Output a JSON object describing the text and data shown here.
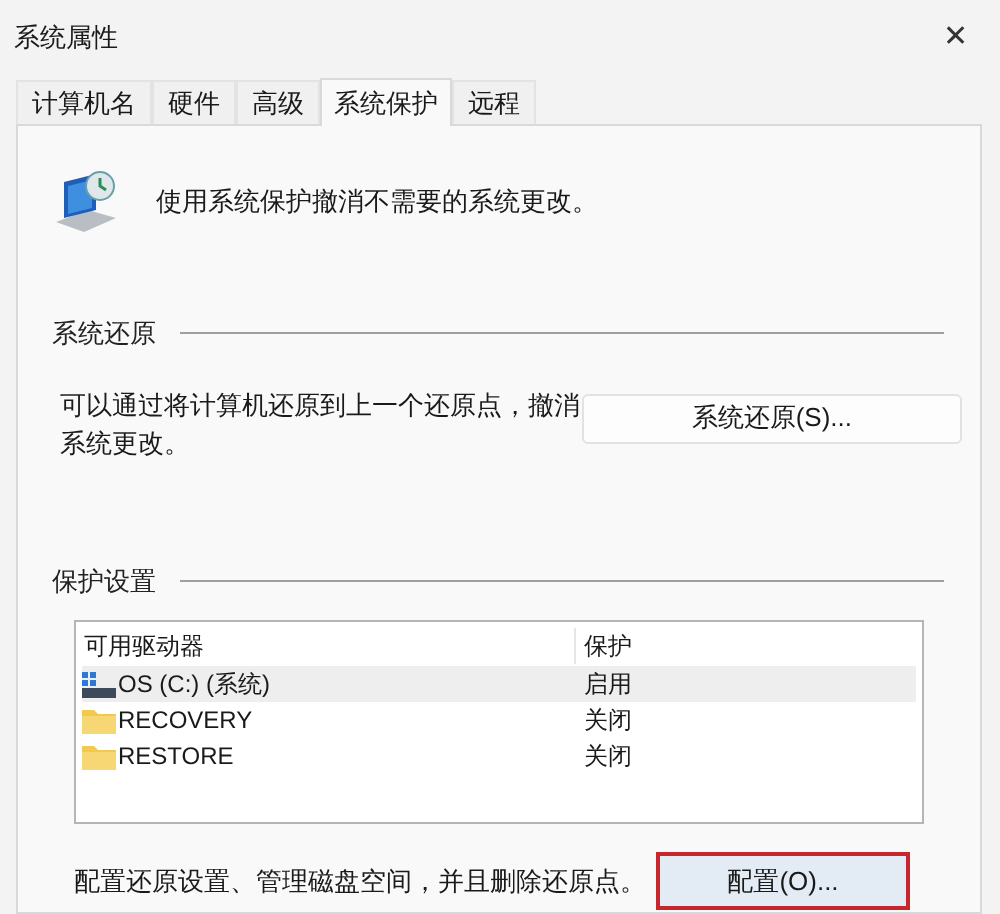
{
  "window": {
    "title": "系统属性",
    "close": "✕"
  },
  "tabs": [
    {
      "label": "计算机名",
      "selected": false
    },
    {
      "label": "硬件",
      "selected": false
    },
    {
      "label": "高级",
      "selected": false
    },
    {
      "label": "系统保护",
      "selected": true
    },
    {
      "label": "远程",
      "selected": false
    }
  ],
  "intro": "使用系统保护撤消不需要的系统更改。",
  "system_restore": {
    "heading": "系统还原",
    "description": "可以通过将计算机还原到上一个还原点，撤消系统更改。",
    "button": "系统还原(S)..."
  },
  "protection": {
    "heading": "保护设置",
    "columns": [
      "可用驱动器",
      "保护"
    ],
    "rows": [
      {
        "kind": "drive",
        "name": "OS (C:) (系统)",
        "protection": "启用",
        "selected": true
      },
      {
        "kind": "folder",
        "name": "RECOVERY",
        "protection": "关闭",
        "selected": false
      },
      {
        "kind": "folder",
        "name": "RESTORE",
        "protection": "关闭",
        "selected": false
      }
    ],
    "description": "配置还原设置、管理磁盘空间，并且删除还原点。",
    "button": {
      "label": "配置(O)...",
      "highlighted": true
    }
  }
}
